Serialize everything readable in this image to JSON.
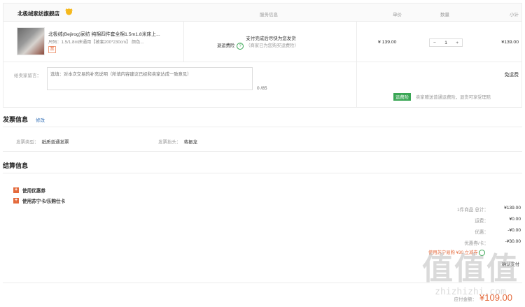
{
  "order": {
    "shop_name": "北极绒家纺旗舰店",
    "columns": {
      "service": "服务信息",
      "unit_price": "单价",
      "quantity": "数量",
      "subtotal": "小计"
    },
    "item": {
      "title": "北极绒(Bejirog)家纺 纯棉四件套全棉1.5m1.8米床上...",
      "spec": "尺码：1.5/1.8m床通用【被套200*230cm】 颜色...",
      "invoice_mark": "票",
      "service_main": "支付完成后尽快为您发货",
      "insurance_label": "退运费险",
      "insurance_icon": "question-icon",
      "insurance_note": "（商家已为您购买运费险）",
      "unit_price": "¥ 139.00",
      "qty_minus": "−",
      "qty": "1",
      "qty_plus": "+",
      "subtotal": "¥139.00"
    },
    "message": {
      "label": "给卖家留言：",
      "placeholder": "选填：对本次交易的补充说明（所填内容建议已经和卖家达成一致意见）",
      "count": "0 /85"
    },
    "shipping": {
      "free": "免运费",
      "tag": "运费险",
      "note": "卖家赠送普通运费险，退货可享受理赔"
    }
  },
  "invoice": {
    "title": "发票信息",
    "edit": "修改",
    "type_label": "发票类型：",
    "type_value": "纸质普通发票",
    "header_label": "发票抬头：",
    "header_value": "蒋振龙"
  },
  "settlement": {
    "title": "结算信息",
    "options": [
      {
        "label": "使用优惠券"
      },
      {
        "label": "使用苏宁卡/乐购仕卡"
      }
    ],
    "rows": [
      {
        "label": "1件商品 总计：",
        "value": "¥139.00"
      },
      {
        "label": "运费：",
        "value": "¥0.00"
      },
      {
        "label": "优惠：",
        "value": "-¥0.00"
      },
      {
        "label": "优惠券/卡：",
        "value": "-¥30.00"
      }
    ],
    "misc": "使用苏宁易购 ¥30 立减券",
    "misc2": "确认支付",
    "total_label": "应付金额：",
    "total_value": "¥109.00"
  },
  "watermark": {
    "logo": "值值值",
    "url": "zhizhizhi.com"
  },
  "colors": {
    "accent": "#e46a3c",
    "green": "#3aa655",
    "link": "#2f6db5",
    "border": "#ececec"
  }
}
